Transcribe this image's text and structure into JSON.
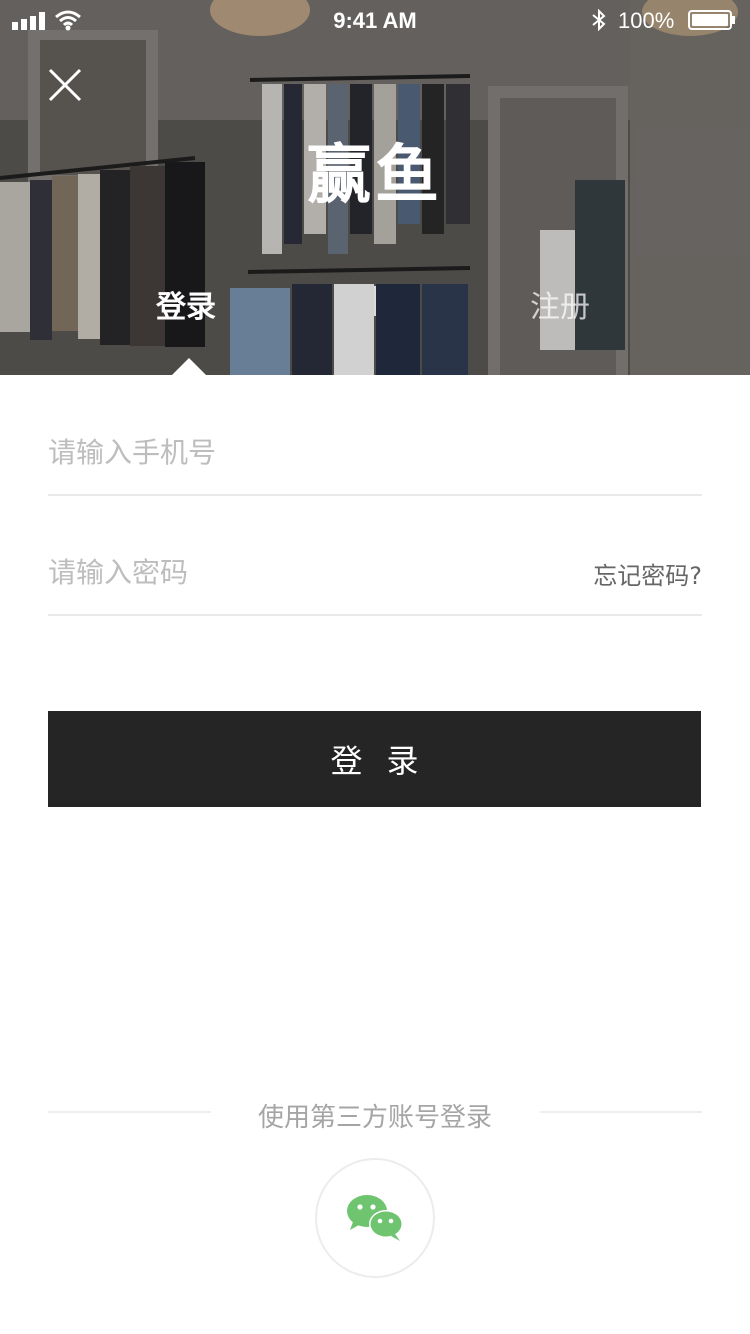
{
  "status_bar": {
    "time": "9:41 AM",
    "battery": "100%"
  },
  "header": {
    "brand": "赢鱼",
    "tabs": [
      {
        "label": "登录",
        "active": true
      },
      {
        "label": "注册",
        "active": false
      }
    ]
  },
  "form": {
    "phone_placeholder": "请输入手机号",
    "password_placeholder": "请输入密码",
    "forgot_password": "忘记密码?",
    "login_button": "登录"
  },
  "third_party": {
    "title": "使用第三方账号登录",
    "providers": [
      {
        "icon": "wechat-icon"
      }
    ]
  },
  "colors": {
    "button_bg": "#252525",
    "wechat_green": "#6fc46f",
    "divider": "#e9e9e9"
  }
}
